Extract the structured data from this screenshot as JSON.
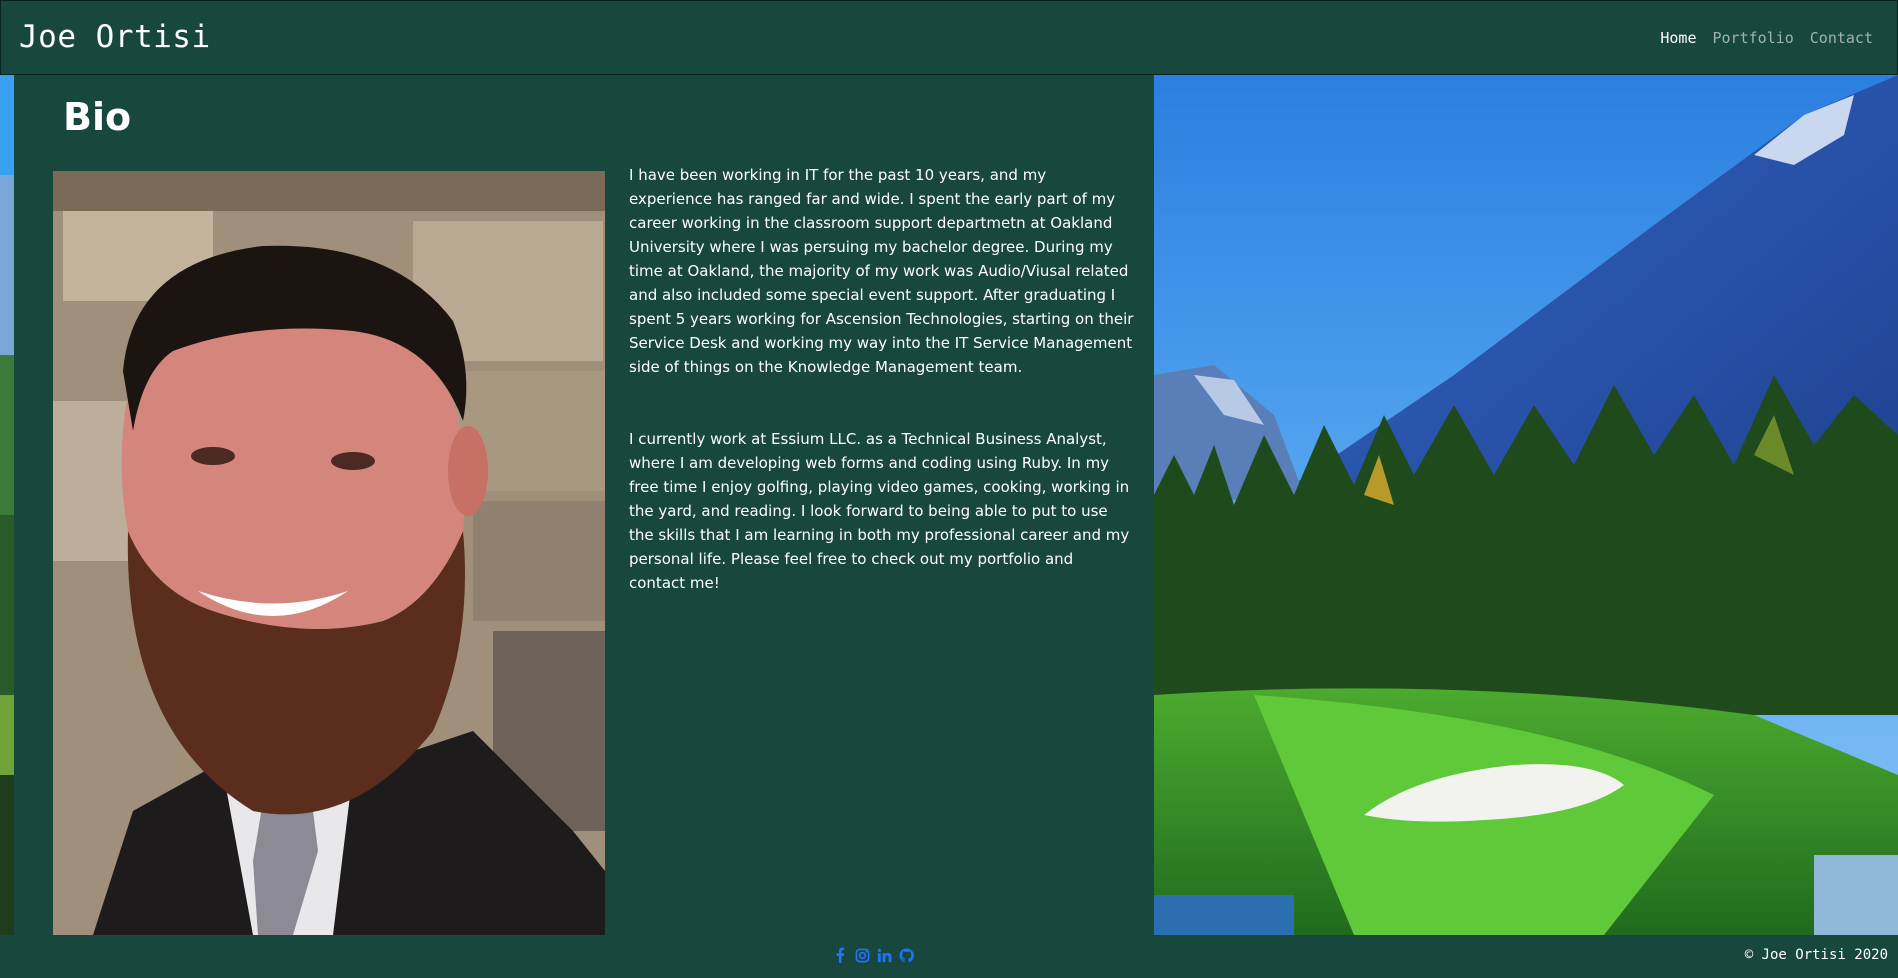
{
  "header": {
    "brand": "Joe Ortisi",
    "nav": [
      {
        "label": "Home",
        "active": true
      },
      {
        "label": "Portfolio",
        "active": false
      },
      {
        "label": "Contact",
        "active": false
      }
    ]
  },
  "bio": {
    "title": "Bio",
    "paragraphs": [
      "I have been working in IT for the past 10 years, and my experience has ranged far and wide. I spent the early part of my career working in the classroom support departmetn at Oakland University where I was persuing my bachelor degree. During my time at Oakland, the majority of my work was Audio/Viusal related and also included some special event support. After graduating I spent 5 years working for Ascension Technologies, starting on their Service Desk and working my way into the IT Service Management side of things on the Knowledge Management team.",
      "I currently work at Essium LLC. as a Technical Business Analyst, where I am developing web forms and coding using Ruby. In my free time I enjoy golfing, playing video games, cooking, working in the yard, and reading. I look forward to being able to put to use the skills that I am learning in both my professional career and my personal life. Please feel free to check out my portfolio and contact me!"
    ]
  },
  "footer": {
    "social_icons": [
      "facebook-icon",
      "instagram-icon",
      "linkedin-icon",
      "github-icon"
    ],
    "copyright": "© Joe Ortisi 2020"
  },
  "colors": {
    "background": "#17473d",
    "social_icon": "#1f73ff"
  }
}
